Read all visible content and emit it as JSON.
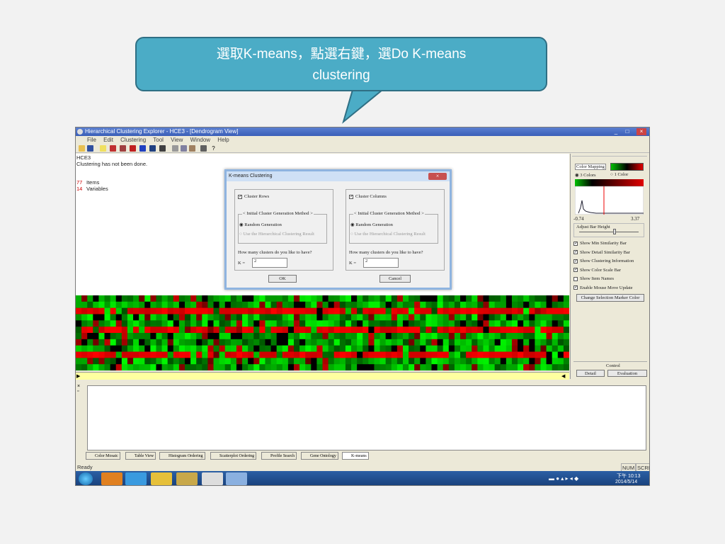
{
  "callout": {
    "line1": "選取K-means，點選右鍵，選Do K-means",
    "line2": "clustering"
  },
  "window": {
    "title": "Hierarchical Clustering Explorer - HCE3 - [Dendrogram View]",
    "menu": [
      "File",
      "Edit",
      "Clustering",
      "Tool",
      "View",
      "Window",
      "Help"
    ]
  },
  "left": {
    "name": "HCE3",
    "message": "Clustering has not been done.",
    "items_count": "77",
    "items_label": "Items",
    "vars_count": "14",
    "vars_label": "Variables"
  },
  "dialog": {
    "title": "K-means Clustering",
    "rows_label": "Cluster Rows",
    "cols_label": "Cluster Columns",
    "method_title": "< Initial Cluster Generation Method >",
    "random": "Random Generation",
    "use_hier": "Use the Hierarchical Clustering Result",
    "question": "How many clusters do you like to have?",
    "k_label": "K =",
    "k_rows": "2",
    "k_cols": "2",
    "ok": "OK",
    "cancel": "Cancel"
  },
  "rpanel": {
    "color_mapping": "Color Mapping",
    "three_colors": "3 Colors",
    "one_color": "1 Color",
    "min": "-0.74",
    "max": "3.37",
    "adjust": "Adjust Bar Height",
    "options": [
      "Show Min Similarity Bar",
      "Show Detail Similarity Bar",
      "Show Clustering Information",
      "Show Color Scale Bar",
      "Show Item Names",
      "Enable Mouse Move Update"
    ],
    "options_checked": [
      true,
      true,
      true,
      true,
      false,
      true
    ],
    "change_btn": "Change Selection Marker Color",
    "control": "Control",
    "detail": "Detail",
    "evaluation": "Evaluation"
  },
  "tabs": [
    "Color Mosaic",
    "Table View",
    "Histogram Ordering",
    "Scatterplot Ordering",
    "Profile Search",
    "Gene Ontology",
    "K-means"
  ],
  "status": {
    "left": "Ready",
    "num": "NUM",
    "scrl": "SCRL"
  },
  "clock": {
    "time": "下午 10:13",
    "date": "2014/5/14"
  },
  "colors": {
    "accent": "#4bacc6",
    "heat_red": "#ff0000",
    "heat_green": "#00cc00"
  },
  "chart_data": {
    "type": "heatmap",
    "rows": 12,
    "cols": 86,
    "values": "green-black-red color mosaic (77 items × 14 variables, not clustered)"
  }
}
